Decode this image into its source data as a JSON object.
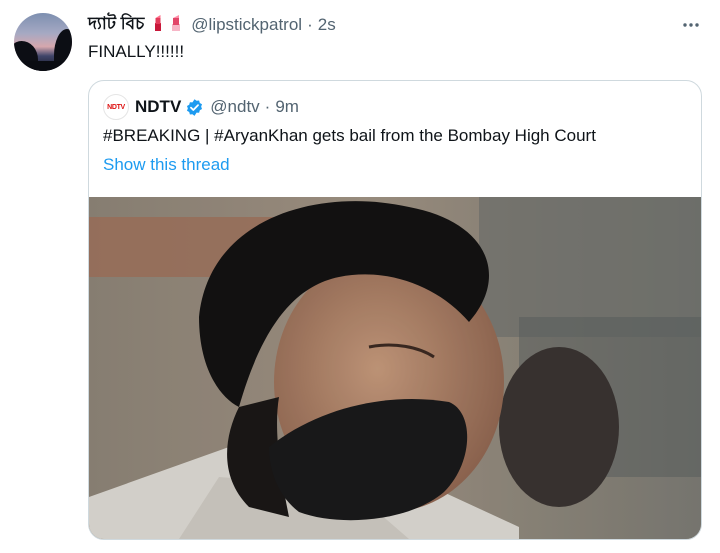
{
  "tweet": {
    "display_name": "দ্যাট বিচ",
    "emojis": [
      "lipstick-emoji",
      "lipstick-emoji"
    ],
    "handle": "@lipstickpatrol",
    "separator": "·",
    "time": "2s",
    "text": "FINALLY!!!!!!",
    "more_icon": "more-icon"
  },
  "quoted": {
    "avatar_text": "NDTV",
    "name": "NDTV",
    "verified": true,
    "handle": "@ndtv",
    "separator": "·",
    "time": "9m",
    "text": "#BREAKING | #AryanKhan gets bail from the Bombay High Court",
    "show_thread": "Show this thread",
    "link_color": "#1d9bf0"
  },
  "colors": {
    "accent": "#1d9bf0",
    "secondary_text": "#536471",
    "border": "#cfd9de"
  }
}
